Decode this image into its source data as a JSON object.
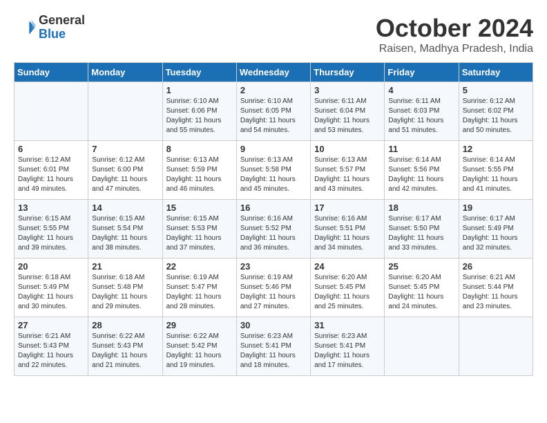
{
  "logo": {
    "general": "General",
    "blue": "Blue"
  },
  "title": "October 2024",
  "location": "Raisen, Madhya Pradesh, India",
  "days_header": [
    "Sunday",
    "Monday",
    "Tuesday",
    "Wednesday",
    "Thursday",
    "Friday",
    "Saturday"
  ],
  "weeks": [
    [
      {
        "day": "",
        "info": ""
      },
      {
        "day": "",
        "info": ""
      },
      {
        "day": "1",
        "info": "Sunrise: 6:10 AM\nSunset: 6:06 PM\nDaylight: 11 hours and 55 minutes."
      },
      {
        "day": "2",
        "info": "Sunrise: 6:10 AM\nSunset: 6:05 PM\nDaylight: 11 hours and 54 minutes."
      },
      {
        "day": "3",
        "info": "Sunrise: 6:11 AM\nSunset: 6:04 PM\nDaylight: 11 hours and 53 minutes."
      },
      {
        "day": "4",
        "info": "Sunrise: 6:11 AM\nSunset: 6:03 PM\nDaylight: 11 hours and 51 minutes."
      },
      {
        "day": "5",
        "info": "Sunrise: 6:12 AM\nSunset: 6:02 PM\nDaylight: 11 hours and 50 minutes."
      }
    ],
    [
      {
        "day": "6",
        "info": "Sunrise: 6:12 AM\nSunset: 6:01 PM\nDaylight: 11 hours and 49 minutes."
      },
      {
        "day": "7",
        "info": "Sunrise: 6:12 AM\nSunset: 6:00 PM\nDaylight: 11 hours and 47 minutes."
      },
      {
        "day": "8",
        "info": "Sunrise: 6:13 AM\nSunset: 5:59 PM\nDaylight: 11 hours and 46 minutes."
      },
      {
        "day": "9",
        "info": "Sunrise: 6:13 AM\nSunset: 5:58 PM\nDaylight: 11 hours and 45 minutes."
      },
      {
        "day": "10",
        "info": "Sunrise: 6:13 AM\nSunset: 5:57 PM\nDaylight: 11 hours and 43 minutes."
      },
      {
        "day": "11",
        "info": "Sunrise: 6:14 AM\nSunset: 5:56 PM\nDaylight: 11 hours and 42 minutes."
      },
      {
        "day": "12",
        "info": "Sunrise: 6:14 AM\nSunset: 5:55 PM\nDaylight: 11 hours and 41 minutes."
      }
    ],
    [
      {
        "day": "13",
        "info": "Sunrise: 6:15 AM\nSunset: 5:55 PM\nDaylight: 11 hours and 39 minutes."
      },
      {
        "day": "14",
        "info": "Sunrise: 6:15 AM\nSunset: 5:54 PM\nDaylight: 11 hours and 38 minutes."
      },
      {
        "day": "15",
        "info": "Sunrise: 6:15 AM\nSunset: 5:53 PM\nDaylight: 11 hours and 37 minutes."
      },
      {
        "day": "16",
        "info": "Sunrise: 6:16 AM\nSunset: 5:52 PM\nDaylight: 11 hours and 36 minutes."
      },
      {
        "day": "17",
        "info": "Sunrise: 6:16 AM\nSunset: 5:51 PM\nDaylight: 11 hours and 34 minutes."
      },
      {
        "day": "18",
        "info": "Sunrise: 6:17 AM\nSunset: 5:50 PM\nDaylight: 11 hours and 33 minutes."
      },
      {
        "day": "19",
        "info": "Sunrise: 6:17 AM\nSunset: 5:49 PM\nDaylight: 11 hours and 32 minutes."
      }
    ],
    [
      {
        "day": "20",
        "info": "Sunrise: 6:18 AM\nSunset: 5:49 PM\nDaylight: 11 hours and 30 minutes."
      },
      {
        "day": "21",
        "info": "Sunrise: 6:18 AM\nSunset: 5:48 PM\nDaylight: 11 hours and 29 minutes."
      },
      {
        "day": "22",
        "info": "Sunrise: 6:19 AM\nSunset: 5:47 PM\nDaylight: 11 hours and 28 minutes."
      },
      {
        "day": "23",
        "info": "Sunrise: 6:19 AM\nSunset: 5:46 PM\nDaylight: 11 hours and 27 minutes."
      },
      {
        "day": "24",
        "info": "Sunrise: 6:20 AM\nSunset: 5:45 PM\nDaylight: 11 hours and 25 minutes."
      },
      {
        "day": "25",
        "info": "Sunrise: 6:20 AM\nSunset: 5:45 PM\nDaylight: 11 hours and 24 minutes."
      },
      {
        "day": "26",
        "info": "Sunrise: 6:21 AM\nSunset: 5:44 PM\nDaylight: 11 hours and 23 minutes."
      }
    ],
    [
      {
        "day": "27",
        "info": "Sunrise: 6:21 AM\nSunset: 5:43 PM\nDaylight: 11 hours and 22 minutes."
      },
      {
        "day": "28",
        "info": "Sunrise: 6:22 AM\nSunset: 5:43 PM\nDaylight: 11 hours and 21 minutes."
      },
      {
        "day": "29",
        "info": "Sunrise: 6:22 AM\nSunset: 5:42 PM\nDaylight: 11 hours and 19 minutes."
      },
      {
        "day": "30",
        "info": "Sunrise: 6:23 AM\nSunset: 5:41 PM\nDaylight: 11 hours and 18 minutes."
      },
      {
        "day": "31",
        "info": "Sunrise: 6:23 AM\nSunset: 5:41 PM\nDaylight: 11 hours and 17 minutes."
      },
      {
        "day": "",
        "info": ""
      },
      {
        "day": "",
        "info": ""
      }
    ]
  ]
}
